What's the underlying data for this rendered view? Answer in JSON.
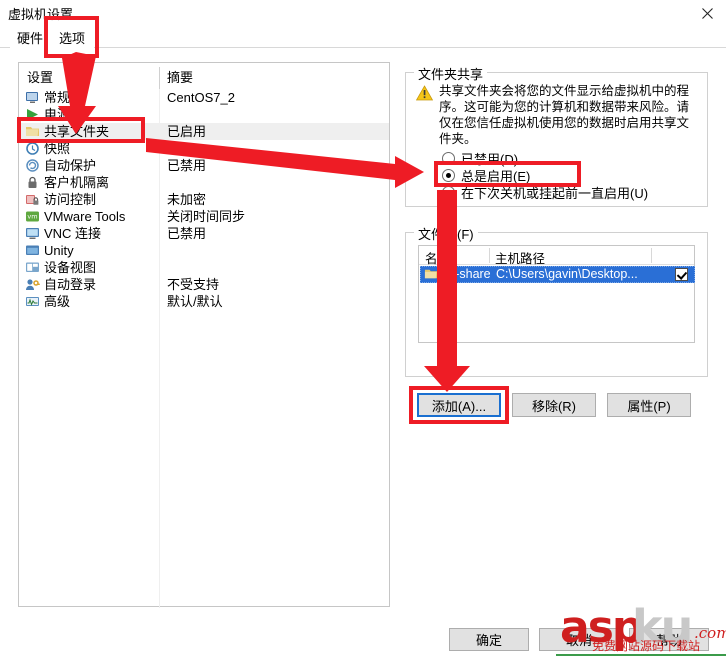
{
  "window": {
    "title": "虚拟机设置",
    "close_icon": "close-icon"
  },
  "tabs": [
    {
      "label": "硬件",
      "selected": false
    },
    {
      "label": "选项",
      "selected": true
    }
  ],
  "settings_list": {
    "columns": [
      "设置",
      "摘要"
    ],
    "rows": [
      {
        "icon": "monitor-icon",
        "label": "常规",
        "summary": "CentOS7_2",
        "selected": false
      },
      {
        "icon": "power-icon",
        "label": "电源",
        "summary": "",
        "selected": false
      },
      {
        "icon": "folder-icon",
        "label": "共享文件夹",
        "summary": "已启用",
        "selected": true
      },
      {
        "icon": "snapshot-icon",
        "label": "快照",
        "summary": "",
        "selected": false
      },
      {
        "icon": "autoprotect-icon",
        "label": "自动保护",
        "summary": "已禁用",
        "selected": false
      },
      {
        "icon": "lock-icon",
        "label": "客户机隔离",
        "summary": "",
        "selected": false
      },
      {
        "icon": "access-control-icon",
        "label": "访问控制",
        "summary": "未加密",
        "selected": false
      },
      {
        "icon": "vmware-tools-icon",
        "label": "VMware Tools",
        "summary": "关闭时间同步",
        "selected": false
      },
      {
        "icon": "vnc-icon",
        "label": "VNC 连接",
        "summary": "已禁用",
        "selected": false
      },
      {
        "icon": "unity-icon",
        "label": "Unity",
        "summary": "",
        "selected": false
      },
      {
        "icon": "device-view-icon",
        "label": "设备视图",
        "summary": "",
        "selected": false
      },
      {
        "icon": "autologin-icon",
        "label": "自动登录",
        "summary": "不受支持",
        "selected": false
      },
      {
        "icon": "advanced-icon",
        "label": "高级",
        "summary": "默认/默认",
        "selected": false
      }
    ]
  },
  "sharing_group": {
    "legend": "文件夹共享",
    "warning_icon": "warning-icon",
    "warning_text": "共享文件夹会将您的文件显示给虚拟机中的程序。这可能为您的计算机和数据带来风险。请仅在您信任虚拟机使用您的数据时启用共享文件夹。",
    "options": [
      {
        "label": "已禁用(D)",
        "checked": false
      },
      {
        "label": "总是启用(E)",
        "checked": true
      },
      {
        "label": "在下次关机或挂起前一直启用(U)",
        "checked": false
      }
    ]
  },
  "folders_group": {
    "legend": "文件夹(F)",
    "columns": [
      "名称",
      "主机路径"
    ],
    "rows": [
      {
        "icon": "folder-icon",
        "name": "pc-share",
        "path": "C:\\Users\\gavin\\Desktop...",
        "enabled": true,
        "selected": true
      }
    ],
    "buttons": [
      {
        "label": "添加(A)...",
        "focused": true
      },
      {
        "label": "移除(R)",
        "focused": false
      },
      {
        "label": "属性(P)",
        "focused": false
      }
    ]
  },
  "dialog_buttons": [
    {
      "label": "确定"
    },
    {
      "label": "取消"
    },
    {
      "label": "帮助"
    }
  ],
  "annotations": {
    "accent_color": "#ee1c25",
    "boxes": [
      "选项 tab",
      "共享文件夹 row",
      "总是启用(E) radio",
      "添加(A)... button"
    ],
    "arrows": 3
  },
  "watermark": {
    "asp": "asp",
    "ku": "ku",
    "com": ".com",
    "subtitle": "免费网站源码下载站"
  }
}
